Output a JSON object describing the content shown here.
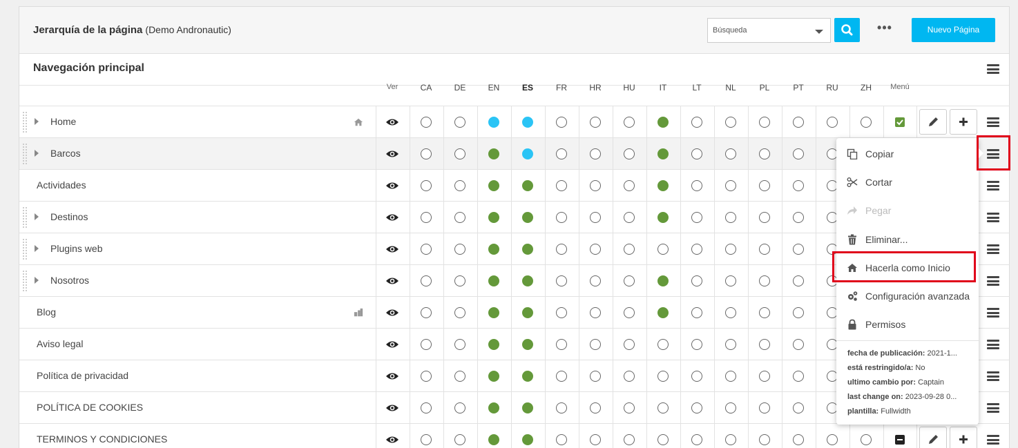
{
  "header": {
    "title": "Jerarquía de la página",
    "subtitle": "(Demo Andronautic)",
    "search_placeholder": "Búsqueda",
    "new_button": "Nuevo Página"
  },
  "navigation": {
    "title": "Navegación principal"
  },
  "columns": {
    "ver": "Ver",
    "languages": [
      "CA",
      "DE",
      "EN",
      "ES",
      "FR",
      "HR",
      "HU",
      "IT",
      "LT",
      "NL",
      "PL",
      "PT",
      "RU",
      "ZH"
    ],
    "active_language": "ES",
    "menu": "Menú"
  },
  "rows": [
    {
      "label": "Home",
      "expandable": true,
      "icon": "home-icon",
      "langs": "..bb...g......",
      "menu": "checked"
    },
    {
      "label": "Barcos",
      "expandable": true,
      "icon": "",
      "langs": "..gb...g......",
      "menu": "",
      "highlighted": true
    },
    {
      "label": "Actividades",
      "expandable": false,
      "icon": "",
      "langs": "..gg...g......",
      "menu": ""
    },
    {
      "label": "Destinos",
      "expandable": true,
      "icon": "",
      "langs": "..gg...g......",
      "menu": ""
    },
    {
      "label": "Plugins web",
      "expandable": true,
      "icon": "",
      "langs": "..gg..........",
      "menu": ""
    },
    {
      "label": "Nosotros",
      "expandable": true,
      "icon": "",
      "langs": "..gg...g......",
      "menu": ""
    },
    {
      "label": "Blog",
      "expandable": false,
      "icon": "blog-icon",
      "langs": "..gg...g......",
      "menu": ""
    },
    {
      "label": "Aviso legal",
      "expandable": false,
      "icon": "",
      "langs": "..gg..........",
      "menu": ""
    },
    {
      "label": "Política de privacidad",
      "expandable": false,
      "icon": "",
      "langs": "..gg..........",
      "menu": ""
    },
    {
      "label": "POLÍTICA DE COOKIES",
      "expandable": false,
      "icon": "",
      "langs": "..gg..........",
      "menu": ""
    },
    {
      "label": "TERMINOS Y CONDICIONES",
      "expandable": false,
      "icon": "",
      "langs": "..gg..........",
      "menu": "minus"
    }
  ],
  "context_menu": {
    "items": [
      {
        "label": "Copiar",
        "icon": "copy-icon",
        "enabled": true
      },
      {
        "label": "Cortar",
        "icon": "scissors-icon",
        "enabled": true
      },
      {
        "label": "Pegar",
        "icon": "paste-arrow-icon",
        "enabled": false
      },
      {
        "label": "Eliminar...",
        "icon": "trash-icon",
        "enabled": true
      },
      {
        "label": "Hacerla como Inicio",
        "icon": "home-icon",
        "enabled": true
      },
      {
        "label": "Configuración avanzada",
        "icon": "gears-icon",
        "enabled": true
      },
      {
        "label": "Permisos",
        "icon": "lock-icon",
        "enabled": true
      }
    ],
    "info": [
      {
        "key": "fecha de publicación:",
        "value": "2021-1..."
      },
      {
        "key": "está restringido/a:",
        "value": "No"
      },
      {
        "key": "ultimo cambio por:",
        "value": "Captain"
      },
      {
        "key": "last change on:",
        "value": "2023-09-28 0..."
      },
      {
        "key": "plantilla:",
        "value": "Fullwidth"
      }
    ]
  },
  "colors": {
    "accent": "#00b7f1",
    "published": "#64993a",
    "current": "#2bc4f5",
    "highlight_box": "#e0001a"
  }
}
